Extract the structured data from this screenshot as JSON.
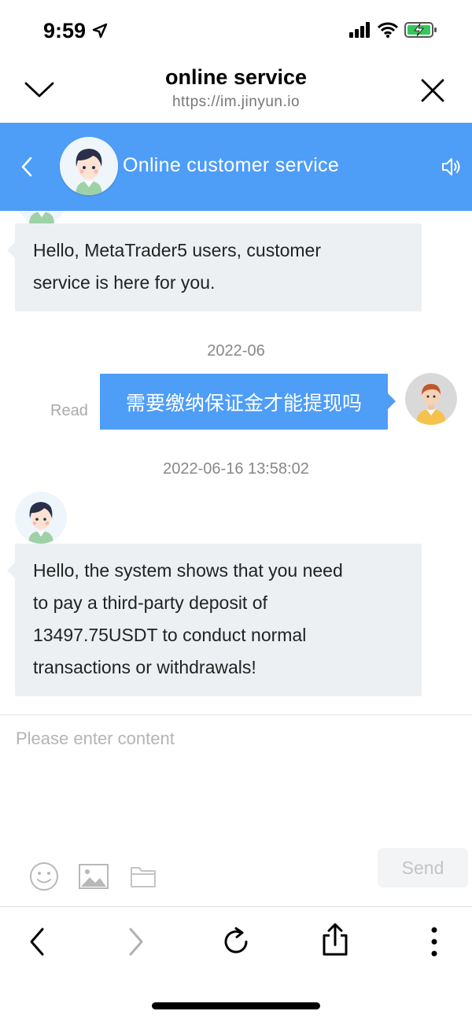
{
  "status_bar": {
    "time": "9:59",
    "icons": [
      "location-arrow-icon",
      "cellular-signal-icon",
      "wifi-icon",
      "battery-charging-icon"
    ]
  },
  "browser": {
    "title": "online service",
    "url": "https://im.jinyun.io",
    "left_icon": "chevron-down-icon",
    "right_icon": "close-icon"
  },
  "chat_header": {
    "title": "Online customer service",
    "back_icon": "chevron-left-icon",
    "sound_icon": "speaker-icon",
    "color": "#4e9df7"
  },
  "messages": {
    "greeting": [
      "Hello, MetaTrader5 users, customer",
      "service is here for you."
    ],
    "date1": "2022-06",
    "user_message": "需要缴纳保证金才能提现吗",
    "read_label": "Read",
    "date2": "2022-06-16 13:58:02",
    "agent_reply": [
      "Hello, the system shows that you need",
      "to pay a third-party deposit of",
      "13497.75USDT to conduct normal",
      "transactions or withdrawals!"
    ]
  },
  "input": {
    "placeholder": "Please enter content",
    "send_label": "Send",
    "tool_icons": [
      "emoji-icon",
      "image-icon",
      "folder-icon"
    ]
  },
  "toolbar": {
    "icons": [
      "back-arrow-icon",
      "forward-arrow-icon",
      "reload-icon",
      "share-icon",
      "more-vertical-icon"
    ]
  }
}
